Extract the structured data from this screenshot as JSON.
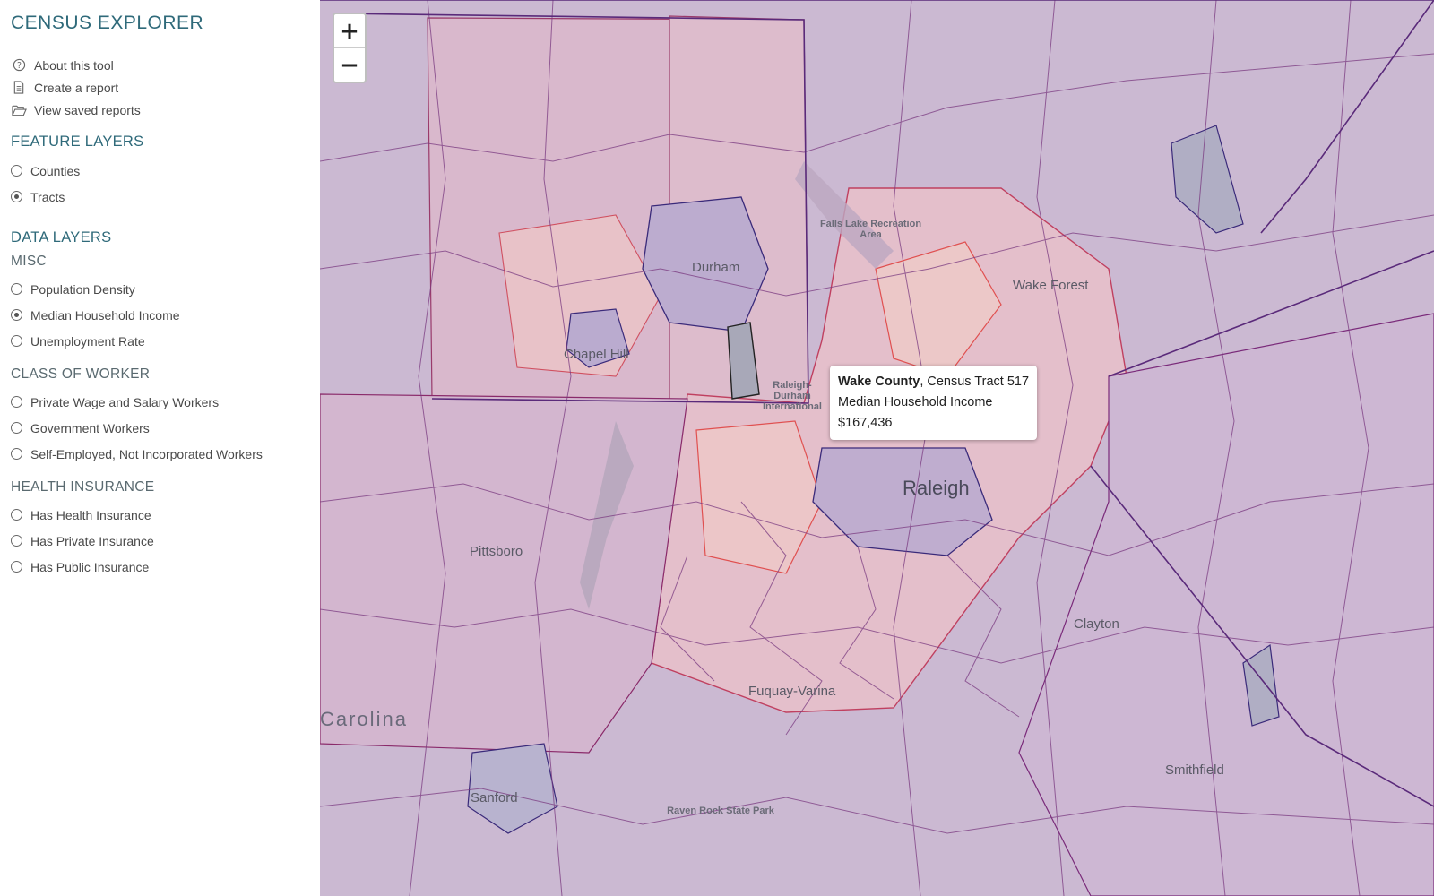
{
  "app": {
    "title": "CENSUS EXPLORER"
  },
  "tools": [
    {
      "label": "About this tool",
      "icon": "question-circle-icon"
    },
    {
      "label": "Create a report",
      "icon": "document-icon"
    },
    {
      "label": "View saved reports",
      "icon": "folder-open-icon"
    }
  ],
  "feature_layers": {
    "title": "FEATURE LAYERS",
    "options": [
      {
        "label": "Counties",
        "selected": false
      },
      {
        "label": "Tracts",
        "selected": true
      }
    ]
  },
  "data_layers": {
    "title": "DATA LAYERS",
    "groups": [
      {
        "title": "MISC",
        "options": [
          {
            "label": "Population Density",
            "selected": false
          },
          {
            "label": "Median Household Income",
            "selected": true
          },
          {
            "label": "Unemployment Rate",
            "selected": false
          }
        ]
      },
      {
        "title": "CLASS OF WORKER",
        "options": [
          {
            "label": "Private Wage and Salary Workers",
            "selected": false
          },
          {
            "label": "Government Workers",
            "selected": false
          },
          {
            "label": "Self-Employed, Not Incorporated Workers",
            "selected": false
          }
        ]
      },
      {
        "title": "HEALTH INSURANCE",
        "options": [
          {
            "label": "Has Health Insurance",
            "selected": false
          },
          {
            "label": "Has Private Insurance",
            "selected": false
          },
          {
            "label": "Has Public Insurance",
            "selected": false
          }
        ]
      }
    ]
  },
  "map": {
    "zoom_in": "+",
    "zoom_out": "−",
    "places": {
      "durham": "Durham",
      "chapel_hill": "Chapel Hill",
      "wake_forest": "Wake Forest",
      "falls_lake": "Falls Lake Recreation Area",
      "rdu": "Raleigh-Durham International",
      "raleigh": "Raleigh",
      "pittsboro": "Pittsboro",
      "clayton": "Clayton",
      "fuquay": "Fuquay-Varina",
      "carolina": "Carolina",
      "sanford": "Sanford",
      "raven_rock": "Raven Rock State Park",
      "smithfield": "Smithfield"
    },
    "tooltip": {
      "county": "Wake County",
      "tract": ", Census Tract 517",
      "metric": "Median Household Income",
      "value": "$167,436"
    }
  }
}
